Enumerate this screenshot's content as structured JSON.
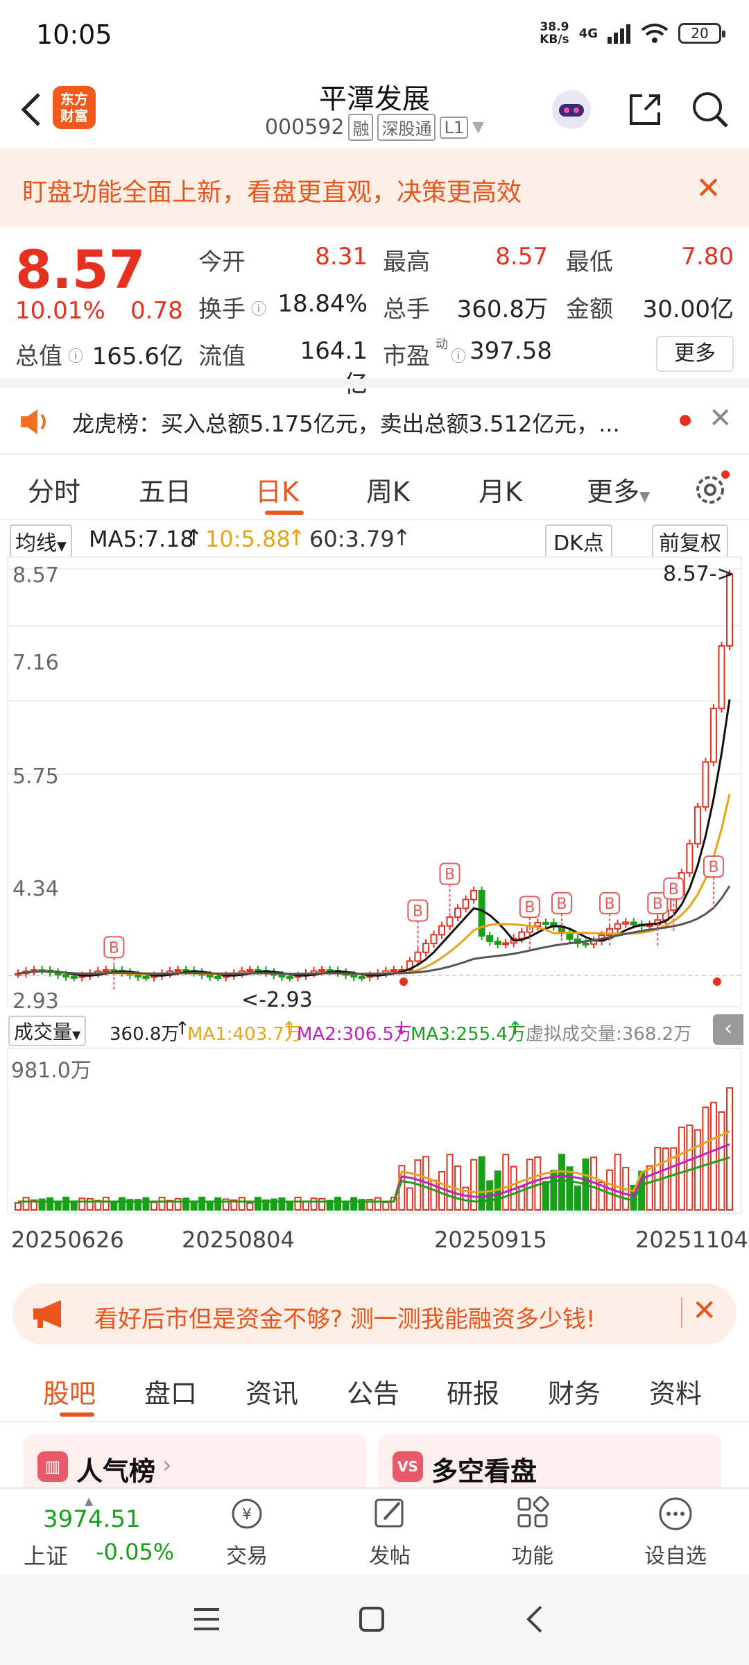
{
  "status": {
    "time": "10:05",
    "net_speed_value": "38.9",
    "net_speed_unit": "KB/s",
    "net_type": "4G",
    "battery": "20"
  },
  "header": {
    "logo_line1": "东方",
    "logo_line2": "财富",
    "stock_name": "平潭发展",
    "stock_code": "000592",
    "tags": [
      "融",
      "深股通",
      "L1"
    ]
  },
  "banner": {
    "text": "盯盘功能全面上新，看盘更直观，决策更高效",
    "close": "✕"
  },
  "quote": {
    "price": "8.57",
    "change_pct": "10.01%",
    "change": "0.78",
    "open_label": "今开",
    "open": "8.31",
    "high_label": "最高",
    "high": "8.57",
    "low_label": "最低",
    "low": "7.80",
    "turnover_label": "换手",
    "turnover": "18.84%",
    "volume_label": "总手",
    "volume": "360.8万",
    "amount_label": "金额",
    "amount": "30.00亿",
    "mktcap_label": "总值",
    "mktcap": "165.6亿",
    "float_label": "流值",
    "float": "164.1亿",
    "pe_label": "市盈",
    "pe_sup": "动",
    "pe": "397.58",
    "more_label": "更多"
  },
  "lhb": {
    "text": "龙虎榜：买入总额5.175亿元，卖出总额3.512亿元，..."
  },
  "chart_tabs": [
    "分时",
    "五日",
    "日K",
    "周K",
    "月K",
    "更多"
  ],
  "ma_row": {
    "selector": "均线",
    "ma5": "MA5:7.18",
    "ma10": "10:5.88",
    "ma60": "60:3.79",
    "dk": "DK点",
    "adjust": "前复权"
  },
  "chart_data": {
    "type": "candlestick",
    "y_ticks": [
      "8.57",
      "7.16",
      "5.75",
      "4.34",
      "2.93"
    ],
    "ylim": [
      2.93,
      8.57
    ],
    "last_label": "8.57->",
    "low_label": "<-2.93",
    "buy_marker": "B",
    "x_dates": [
      "20250626",
      "20250804",
      "20250915",
      "20251104"
    ],
    "volume_max_label": "981.0万"
  },
  "vol_row": {
    "selector": "成交量",
    "vol": "360.8万",
    "ma1": "MA1:403.7万",
    "ma2": "MA2:306.5万",
    "ma3": "MA3:255.4万",
    "virtual": "虚拟成交量:368.2万"
  },
  "promo": {
    "text": "看好后市但是资金不够? 测一测我能融资多少钱!"
  },
  "bottom_tabs": [
    "股吧",
    "盘口",
    "资讯",
    "公告",
    "研报",
    "财务",
    "资料"
  ],
  "cards": {
    "popularity": "人气榜",
    "bull_bear": "多空看盘"
  },
  "footer": {
    "index_value": "3974.51",
    "index_name": "上证",
    "index_change": "-0.05%",
    "trade": "交易",
    "post": "发帖",
    "functions": "功能",
    "add_watch": "设自选"
  },
  "colors": {
    "accent": "#e8551d",
    "up": "#e63020",
    "down": "#19a019"
  }
}
